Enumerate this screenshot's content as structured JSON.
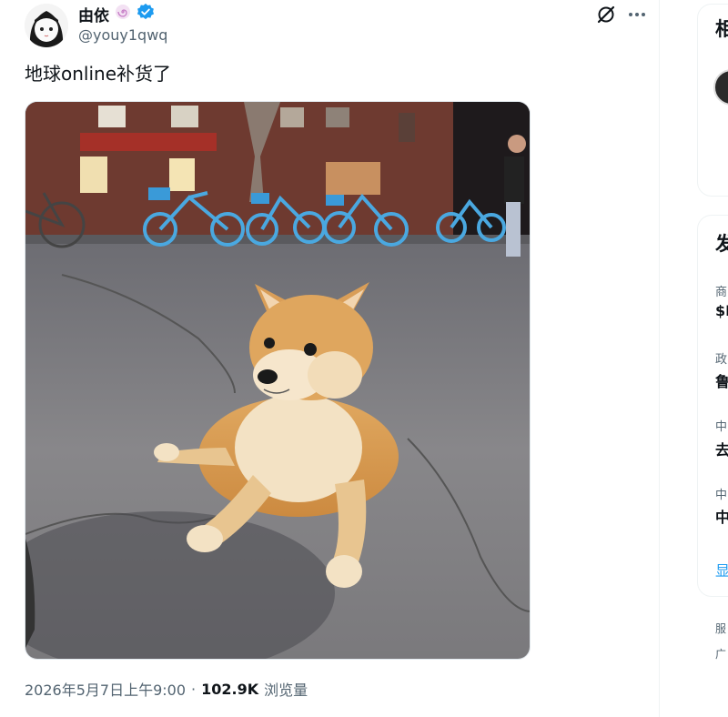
{
  "tweet": {
    "display_name": "由依",
    "handle": "@youy1qwq",
    "text": "地球online补货了",
    "timestamp": "2026年5月7日上午9:00",
    "separator": "·",
    "views_count": "102.9K",
    "views_label": "浏览量",
    "verified_color": "#1d9bf0",
    "badge_color": "#c77dc7"
  },
  "icons": {
    "verified": "verified-badge-icon",
    "profile_badge": "swirl-badge-icon",
    "grok": "grok-icon",
    "more": "more-icon"
  },
  "sidebar": {
    "card1_title": "相",
    "card2_title": "发",
    "items": [
      {
        "label": "商",
        "value": "$I"
      },
      {
        "label": "政",
        "value": "鲁"
      },
      {
        "label": "中",
        "value": "去"
      },
      {
        "label": "中",
        "value": "中"
      }
    ],
    "show_more": "显",
    "footer": [
      "服",
      "广"
    ]
  },
  "colors": {
    "accent": "#1d9bf0",
    "text_primary": "#0f1419",
    "text_secondary": "#536471"
  }
}
